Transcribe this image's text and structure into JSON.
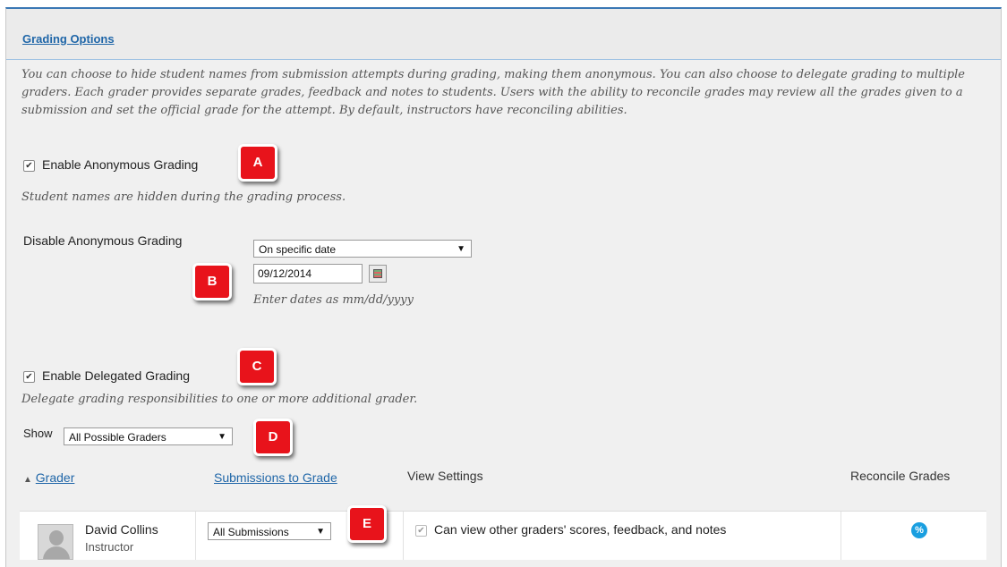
{
  "header": {
    "title": "Grading Options"
  },
  "intro": "You can choose to hide student names from submission attempts during grading, making them anonymous. You can also choose to delegate grading to multiple graders. Each grader provides separate grades, feedback and notes to students. Users with the ability to reconcile grades may review all the grades given to a submission and set the official grade for the attempt. By default, instructors have reconciling abilities.",
  "anonymous": {
    "label": "Enable Anonymous Grading",
    "checked": true,
    "help": "Student names are hidden during the grading process."
  },
  "disable_anonymous": {
    "label": "Disable Anonymous Grading",
    "selected": "On specific date",
    "date_value": "09/12/2014",
    "date_hint": "Enter dates as mm/dd/yyyy"
  },
  "delegated": {
    "label": "Enable Delegated Grading",
    "checked": true,
    "help": "Delegate grading responsibilities to one or more additional grader."
  },
  "show": {
    "label": "Show",
    "selected": "All Possible Graders"
  },
  "table": {
    "headers": {
      "grader": "Grader",
      "submissions": "Submissions to Grade",
      "view_settings": "View Settings",
      "reconcile": "Reconcile Grades"
    },
    "rows": [
      {
        "name": "David Collins",
        "role": "Instructor",
        "submissions": "All Submissions",
        "view_setting": "Can view other graders' scores, feedback, and notes",
        "reconcile_icon": "reconcile-icon"
      }
    ]
  },
  "badges": {
    "a": "A",
    "b": "B",
    "c": "C",
    "d": "D",
    "e": "E"
  },
  "colors": {
    "accent": "#1f66a8",
    "badge": "#e8131b",
    "reconcile": "#1a9fe0",
    "header_border": "#3a78b5"
  }
}
